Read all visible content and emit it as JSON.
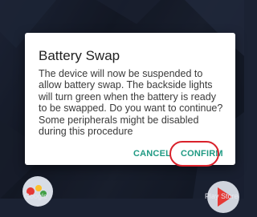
{
  "dialog": {
    "title": "Battery Swap",
    "message": "The device will now be suspended to\nallow battery swap. The backside lights\nwill turn green when the battery is ready\nto be swapped. Do you want to continue?\nSome peripherals might be disabled\nduring this procedure",
    "cancel_label": "CANCEL",
    "confirm_label": "CONFIRM"
  },
  "home": {
    "dock_left_label": "Google",
    "dock_right_label": "Play Store"
  },
  "colors": {
    "accent": "#1f9a83",
    "highlight": "#d9212b",
    "dialog_bg": "#ffffff"
  },
  "icons": [
    "google-folder-icon",
    "play-store-icon"
  ]
}
